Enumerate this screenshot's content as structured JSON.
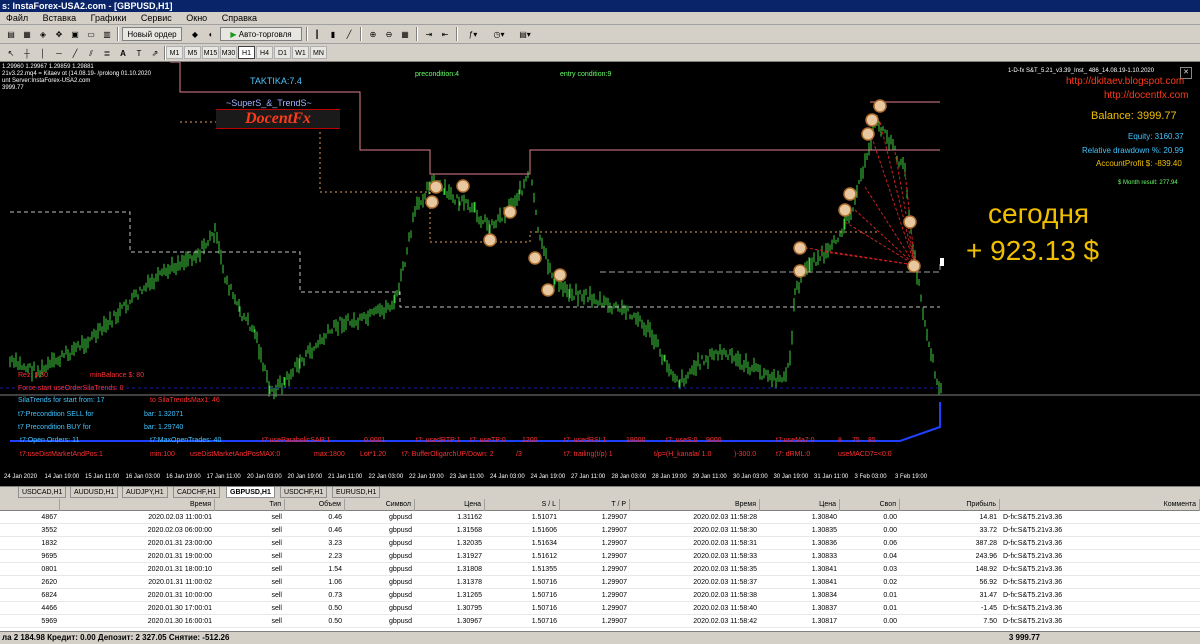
{
  "window": {
    "title": "s: InstaForex-USA2.com - [GBPUSD,H1]"
  },
  "menu": [
    "Файл",
    "Вставка",
    "Графики",
    "Сервис",
    "Окно",
    "Справка"
  ],
  "toolbar": {
    "new_order": "Новый ордер",
    "autotrading": "Авто-торговля"
  },
  "timeframes": [
    "M1",
    "M5",
    "M15",
    "M30",
    "H1",
    "H4",
    "D1",
    "W1",
    "MN"
  ],
  "active_timeframe": "H1",
  "chart": {
    "info_lines": [
      "1.29960 1.29967 1.29859 1.29881",
      "21v3.22.mq4 = Kitaev ot (14.08.19- /prolong 01.10.2020",
      "unt Server:InstaForex-USA2.com",
      "3999.77"
    ],
    "taktika": "TAKTIKA:7.4",
    "precondition": "precondition:4",
    "entry_condition": "entry condition:9",
    "logo_small": "~SuperS_&_TrendS~",
    "logo_main": "DocentFx",
    "ea_name": "1-D-fx S&T_5.21_v3.39_Inst_          486_14.08.19-1.10.2020",
    "links": [
      "http://dkitaev.blogspot.com",
      "http://docentfx.com"
    ],
    "balance": "Balance: 3999.77",
    "equity": "Equity: 3160.37",
    "drawdown": "Relative drawdown %: 20.99",
    "account_profit": "AccountProfit $: -839.40",
    "month_result": "$ Month result: 277.94",
    "today_label": "сегодня",
    "today_value": "+ 923.13 $",
    "red_lines": [
      "Rez: 1.30",
      "Force start useOrderSilaTrends: 0"
    ],
    "balance_line": "minBalance $: 80",
    "sila_trend": "SilaTrends for start from: 17",
    "sila_trend_max": "to SilaTrendsMax1: 46",
    "precond_sell": "t7:Precondition  SELL for",
    "precond_buy": "t7 Precondition  BUY  for",
    "bar_sell": "bar: 1.32071",
    "bar_buy": "bar: 1.29740",
    "row1": [
      "t7:Open Orders: 11",
      "t7:MaxOpenTrades: 40",
      "t7:useParabolicSAR:1",
      "0.0001",
      "t7: usedRTP:1",
      "t7: useTP:0",
      "1200",
      "t7: usedRSI:1",
      "19000",
      "t7: useS:0",
      "9000",
      "t7:useMa7:0",
      "8",
      "75",
      "85"
    ],
    "row2": [
      "t7:useDistMarketAndPos:1",
      "min:100",
      "useDistMarketAndPosMAX:0",
      "max:1800",
      "Lot*1.20",
      "t7: BufferOligarchUP/Down: 2",
      "/3",
      "t7: trailing(t/p) 1",
      "t/p=(H_kanala/ 1.0",
      ")-300.0",
      "t7: dRML:0",
      "useMACD7=<0:0"
    ],
    "time_labels": [
      "24 Jan 2020",
      "14 Jan 19:00",
      "15 Jan 11:00",
      "16 Jan 03:00",
      "16 Jan 19:00",
      "17 Jan 11:00",
      "20 Jan 03:00",
      "20 Jan 19:00",
      "21 Jan 11:00",
      "22 Jan 03:00",
      "22 Jan 19:00",
      "23 Jan 11:00",
      "24 Jan 03:00",
      "24 Jan 19:00",
      "27 Jan 11:00",
      "28 Jan 03:00",
      "28 Jan 19:00",
      "29 Jan 11:00",
      "30 Jan 03:00",
      "30 Jan 19:00",
      "31 Jan 11:00",
      "3 Feb 03:00",
      "3 Feb 19:00"
    ]
  },
  "symbol_tabs": [
    "USDCAD,H1",
    "AUDUSD,H1",
    "AUDJPY,H1",
    "CADCHF,H1",
    "GBPUSD,H1",
    "USDCHF,H1",
    "EURUSD,H1"
  ],
  "active_tab": "GBPUSD,H1",
  "table": {
    "headers": [
      "",
      "Время",
      "Тип",
      "Объем",
      "Символ",
      "Цена",
      "S / L",
      "T / P",
      "Время",
      "Цена",
      "Своп",
      "Прибыль",
      "Коммента"
    ],
    "rows": [
      [
        "4867",
        "2020.02.03 11:00:01",
        "sell",
        "0.46",
        "gbpusd",
        "1.31162",
        "1.51071",
        "1.29907",
        "2020.02.03 11:58:28",
        "1.30840",
        "0.00",
        "14.81",
        "D-fx:S&T5.21v3.36"
      ],
      [
        "3552",
        "2020.02.03 06:00:00",
        "sell",
        "0.46",
        "gbpusd",
        "1.31568",
        "1.51606",
        "1.29907",
        "2020.02.03 11:58:30",
        "1.30835",
        "0.00",
        "33.72",
        "D-fx:S&T5.21v3.36"
      ],
      [
        "1832",
        "2020.01.31 23:00:00",
        "sell",
        "3.23",
        "gbpusd",
        "1.32035",
        "1.51634",
        "1.29907",
        "2020.02.03 11:58:31",
        "1.30836",
        "0.06",
        "387.28",
        "D-fx:S&T5.21v3.36"
      ],
      [
        "9695",
        "2020.01.31 19:00:00",
        "sell",
        "2.23",
        "gbpusd",
        "1.31927",
        "1.51612",
        "1.29907",
        "2020.02.03 11:58:33",
        "1.30833",
        "0.04",
        "243.96",
        "D-fx:S&T5.21v3.36"
      ],
      [
        "0801",
        "2020.01.31 18:00:10",
        "sell",
        "1.54",
        "gbpusd",
        "1.31808",
        "1.51355",
        "1.29907",
        "2020.02.03 11:58:35",
        "1.30841",
        "0.03",
        "148.92",
        "D-fx:S&T5.21v3.36"
      ],
      [
        "2620",
        "2020.01.31 11:00:02",
        "sell",
        "1.06",
        "gbpusd",
        "1.31378",
        "1.50716",
        "1.29907",
        "2020.02.03 11:58:37",
        "1.30841",
        "0.02",
        "56.92",
        "D-fx:S&T5.21v3.36"
      ],
      [
        "6824",
        "2020.01.31 10:00:00",
        "sell",
        "0.73",
        "gbpusd",
        "1.31265",
        "1.50716",
        "1.29907",
        "2020.02.03 11:58:38",
        "1.30834",
        "0.01",
        "31.47",
        "D-fx:S&T5.21v3.36"
      ],
      [
        "4466",
        "2020.01.30 17:00:01",
        "sell",
        "0.50",
        "gbpusd",
        "1.30795",
        "1.50716",
        "1.29907",
        "2020.02.03 11:58:40",
        "1.30837",
        "0.01",
        "-1.45",
        "D-fx:S&T5.21v3.36"
      ],
      [
        "5969",
        "2020.01.30 16:00:01",
        "sell",
        "0.50",
        "gbpusd",
        "1.30967",
        "1.50716",
        "1.29907",
        "2020.02.03 11:58:42",
        "1.30817",
        "0.00",
        "7.50",
        "D-fx:S&T5.21v3.36"
      ]
    ]
  },
  "status": {
    "left": "ла 2 184.98  Кредит: 0.00  Депозит: 2 327.05  Снятие: -512.26",
    "right": "3 999.77"
  }
}
